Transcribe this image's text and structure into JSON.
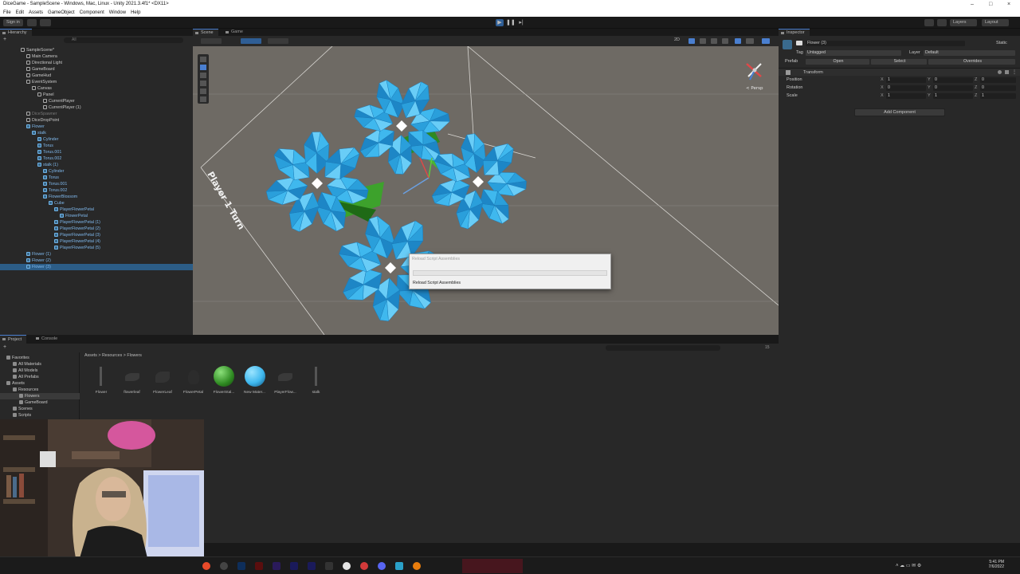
{
  "window": {
    "title": "DiceGame - SampleScene - Windows, Mac, Linux - Unity 2021.3.4f1* <DX11>",
    "menu": [
      "File",
      "Edit",
      "Assets",
      "GameObject",
      "Component",
      "Window",
      "Help"
    ]
  },
  "toolbar": {
    "sign_in": "Sign in",
    "layers": "Layers",
    "layout": "Layout"
  },
  "hierarchy": {
    "tab": "Hierarchy",
    "search_placeholder": "All",
    "items": [
      {
        "label": "SampleScene*",
        "indent": 0,
        "kind": "scene"
      },
      {
        "label": "Main Camera",
        "indent": 1,
        "kind": "obj"
      },
      {
        "label": "Directional Light",
        "indent": 1,
        "kind": "obj"
      },
      {
        "label": "GameBoard",
        "indent": 1,
        "kind": "obj"
      },
      {
        "label": "GameHud",
        "indent": 1,
        "kind": "obj"
      },
      {
        "label": "EventSystem",
        "indent": 1,
        "kind": "obj"
      },
      {
        "label": "Canvas",
        "indent": 2,
        "kind": "obj"
      },
      {
        "label": "Panel",
        "indent": 3,
        "kind": "obj"
      },
      {
        "label": "CurrentPlayer",
        "indent": 4,
        "kind": "obj"
      },
      {
        "label": "CurrentPlayer (1)",
        "indent": 4,
        "kind": "obj"
      },
      {
        "label": "DiceSpawner",
        "indent": 1,
        "kind": "dim"
      },
      {
        "label": "DiceDropPoint",
        "indent": 1,
        "kind": "obj"
      },
      {
        "label": "Flower",
        "indent": 1,
        "kind": "prefab"
      },
      {
        "label": "stalk",
        "indent": 2,
        "kind": "prefab"
      },
      {
        "label": "Cylinder",
        "indent": 3,
        "kind": "prefab"
      },
      {
        "label": "Torus",
        "indent": 3,
        "kind": "prefab"
      },
      {
        "label": "Torus.001",
        "indent": 3,
        "kind": "prefab"
      },
      {
        "label": "Torus.002",
        "indent": 3,
        "kind": "prefab"
      },
      {
        "label": "stalk (1)",
        "indent": 3,
        "kind": "prefab"
      },
      {
        "label": "Cylinder",
        "indent": 4,
        "kind": "prefab"
      },
      {
        "label": "Torus",
        "indent": 4,
        "kind": "prefab"
      },
      {
        "label": "Torus.001",
        "indent": 4,
        "kind": "prefab"
      },
      {
        "label": "Torus.002",
        "indent": 4,
        "kind": "prefab"
      },
      {
        "label": "FlowerBlossom",
        "indent": 4,
        "kind": "prefab"
      },
      {
        "label": "Cube",
        "indent": 5,
        "kind": "prefab"
      },
      {
        "label": "PlayerFlowerPetal",
        "indent": 6,
        "kind": "prefab"
      },
      {
        "label": "FlowerPetal",
        "indent": 7,
        "kind": "prefab"
      },
      {
        "label": "PlayerFlowerPetal (1)",
        "indent": 6,
        "kind": "prefab"
      },
      {
        "label": "PlayerFlowerPetal (2)",
        "indent": 6,
        "kind": "prefab"
      },
      {
        "label": "PlayerFlowerPetal (3)",
        "indent": 6,
        "kind": "prefab"
      },
      {
        "label": "PlayerFlowerPetal (4)",
        "indent": 6,
        "kind": "prefab"
      },
      {
        "label": "PlayerFlowerPetal (5)",
        "indent": 6,
        "kind": "prefab"
      },
      {
        "label": "Flower (1)",
        "indent": 1,
        "kind": "prefab"
      },
      {
        "label": "Flower (2)",
        "indent": 1,
        "kind": "prefab"
      },
      {
        "label": "Flower (3)",
        "indent": 1,
        "kind": "selected"
      }
    ]
  },
  "scene": {
    "tab_scene": "Scene",
    "tab_game": "Game",
    "board_text": "Player 1 Turn",
    "persp": "< Persp",
    "mode_2d": "2D"
  },
  "dialog": {
    "title": "Reload Script Assemblies",
    "status": "Reload Script Assemblies",
    "progress": 0
  },
  "inspector": {
    "tab": "Inspector",
    "object_name": "Flower (3)",
    "static": "Static",
    "tag_label": "Tag",
    "tag_value": "Untagged",
    "layer_label": "Layer",
    "layer_value": "Default",
    "prefab_label": "Prefab",
    "open": "Open",
    "select": "Select",
    "overrides": "Overrides",
    "transform": "Transform",
    "rows": [
      {
        "label": "Position",
        "x": "1",
        "y": "0",
        "z": "0"
      },
      {
        "label": "Rotation",
        "x": "0",
        "y": "0",
        "z": "0"
      },
      {
        "label": "Scale",
        "x": "1",
        "y": "1",
        "z": "1"
      }
    ],
    "add_component": "Add Component"
  },
  "project": {
    "tab_project": "Project",
    "tab_console": "Console",
    "breadcrumb": [
      "Assets",
      "Resources",
      "Flowers"
    ],
    "asset_count": "15",
    "tree": [
      {
        "label": "Favorites",
        "indent": 0
      },
      {
        "label": "All Materials",
        "indent": 1
      },
      {
        "label": "All Models",
        "indent": 1
      },
      {
        "label": "All Prefabs",
        "indent": 1
      },
      {
        "label": "Assets",
        "indent": 0
      },
      {
        "label": "Resources",
        "indent": 1
      },
      {
        "label": "Flowers",
        "indent": 2
      },
      {
        "label": "GameBoard",
        "indent": 2
      },
      {
        "label": "Scenes",
        "indent": 1
      },
      {
        "label": "Scripts",
        "indent": 1
      }
    ],
    "assets": [
      {
        "label": "Flower",
        "kind": "stick"
      },
      {
        "label": "flowerleaf",
        "kind": "leaf"
      },
      {
        "label": "FlowerLeaf",
        "kind": "leafdark"
      },
      {
        "label": "FlowerPetal",
        "kind": "petal"
      },
      {
        "label": "FlowerStal...",
        "kind": "green"
      },
      {
        "label": "New Mater...",
        "kind": "blue"
      },
      {
        "label": "PlayerFlow...",
        "kind": "leaf"
      },
      {
        "label": "stalk",
        "kind": "stick"
      }
    ]
  },
  "taskbar": {
    "time": "5:41 PM",
    "date": "7/6/2022"
  },
  "colors": {
    "petal": "#3fb8ee",
    "petal_dark": "#1d86c6",
    "stem": "#2f8a22",
    "ground": "#6e6a64",
    "accent": "#4a7fd0"
  }
}
